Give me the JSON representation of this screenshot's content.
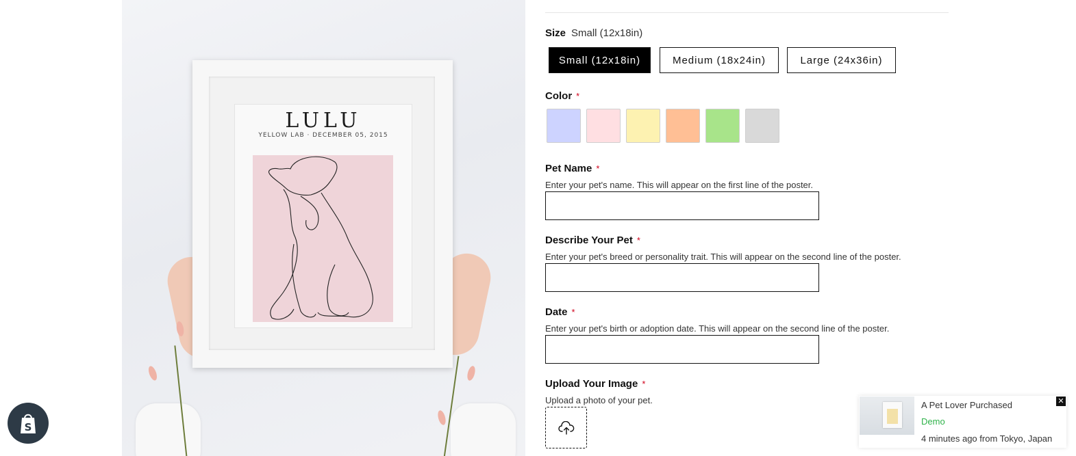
{
  "product_image": {
    "poster_title": "LULU",
    "poster_subtitle": "YELLOW LAB · DECEMBER 05, 2015"
  },
  "size": {
    "label": "Size",
    "selected_value": "Small (12x18in)",
    "options": [
      "Small (12x18in)",
      "Medium (18x24in)",
      "Large (24x36in)"
    ]
  },
  "color": {
    "label": "Color",
    "required_mark": "*",
    "swatches": [
      "#cdd3ff",
      "#ffdfe2",
      "#fdf2b1",
      "#ffbf95",
      "#a8e48a",
      "#d9d9d9"
    ]
  },
  "pet_name": {
    "label": "Pet Name",
    "required_mark": "*",
    "help": "Enter your pet's name. This will appear on the first line of the poster.",
    "value": ""
  },
  "describe_pet": {
    "label": "Describe Your Pet",
    "required_mark": "*",
    "help": "Enter your pet's breed or personality trait. This will appear on the second line of the poster.",
    "value": ""
  },
  "date": {
    "label": "Date",
    "required_mark": "*",
    "help": "Enter your pet's birth or adoption date. This will appear on the second line of the poster.",
    "value": ""
  },
  "upload": {
    "label": "Upload Your Image",
    "required_mark": "*",
    "help": "Upload a photo of your pet.",
    "icon": "cloud-upload-icon"
  },
  "notification": {
    "title": "A Pet Lover Purchased",
    "product": "Demo",
    "meta": "4 minutes ago from Tokyo, Japan",
    "close_glyph": "✕"
  },
  "shopify_badge": {
    "icon": "shopify-bag-icon",
    "glyph": "S"
  },
  "colors": {
    "accent_green": "#2fb34a",
    "required_red": "#d0021b",
    "badge_bg": "#2d3a46"
  }
}
